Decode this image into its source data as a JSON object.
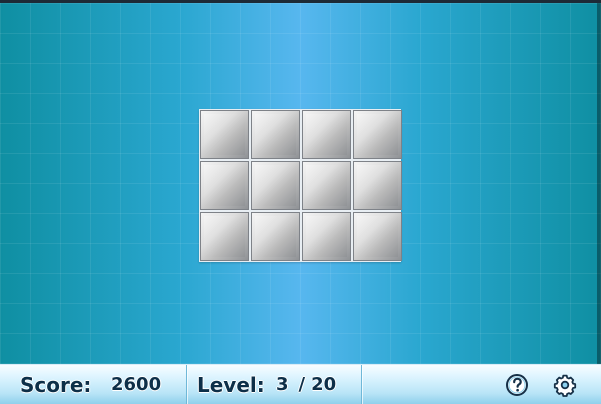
{
  "hud": {
    "score_label": "Score:",
    "score_value": "2600",
    "level_label": "Level:",
    "level_current": "3",
    "level_separator": "/",
    "level_total": "20"
  },
  "board": {
    "rows": 3,
    "cols": 4
  },
  "icons": {
    "help": "help-icon",
    "settings": "gear-icon"
  },
  "colors": {
    "background_center": "#57b7ef",
    "background_edge": "#0f8fa2",
    "hud": "#b9e5f7",
    "tile_light": "#f5f5f5",
    "tile_dark": "#8f9296",
    "text": "#0d2f48"
  }
}
